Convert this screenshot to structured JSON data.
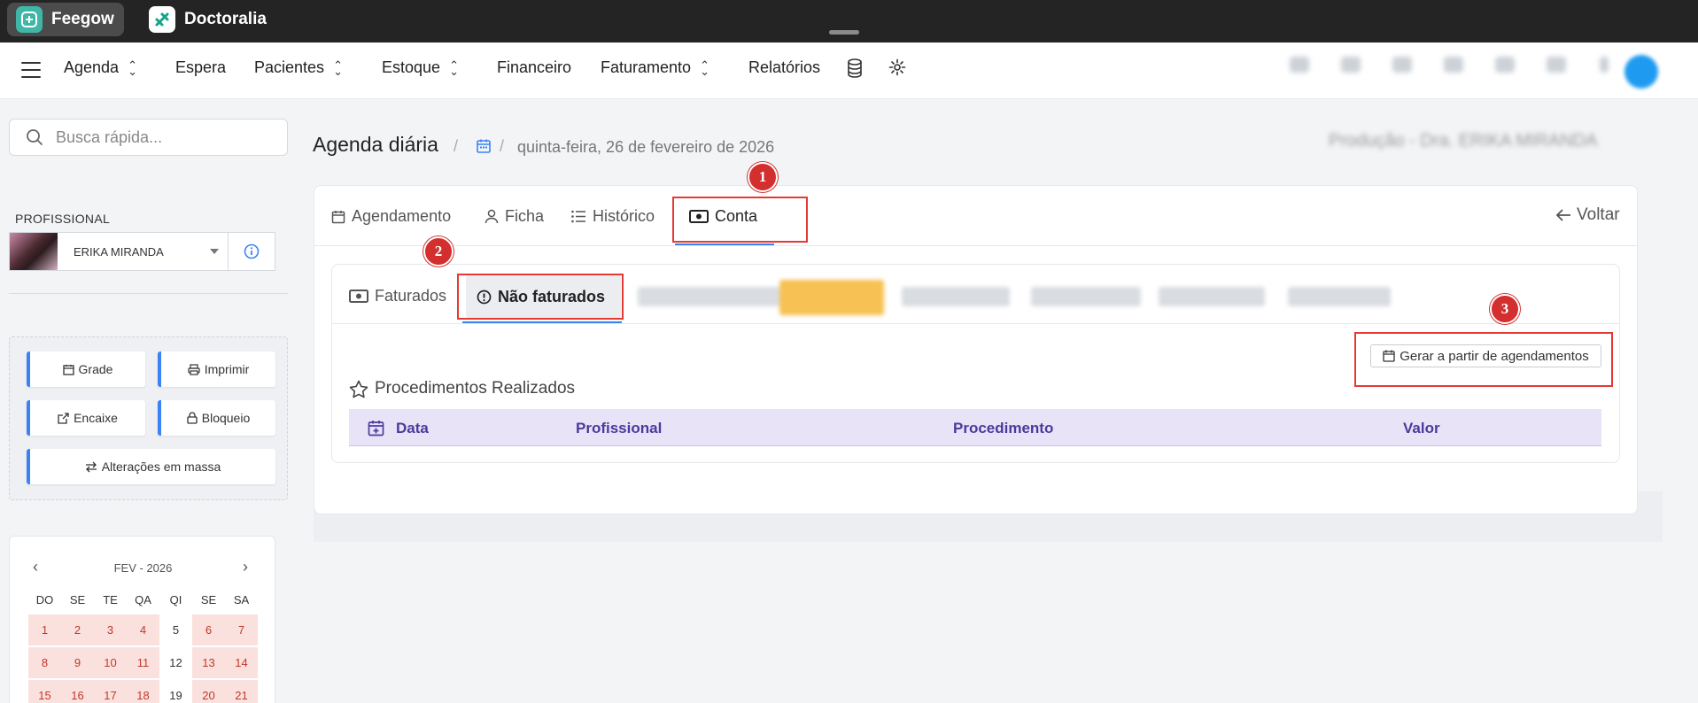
{
  "topbar": {
    "apps": [
      {
        "label": "Feegow",
        "active": true
      },
      {
        "label": "Doctoralia",
        "active": false
      }
    ]
  },
  "nav": {
    "items": [
      {
        "label": "Agenda",
        "dropdown": true
      },
      {
        "label": "Espera",
        "dropdown": false
      },
      {
        "label": "Pacientes",
        "dropdown": true
      },
      {
        "label": "Estoque",
        "dropdown": true
      },
      {
        "label": "Financeiro",
        "dropdown": false
      },
      {
        "label": "Faturamento",
        "dropdown": true
      },
      {
        "label": "Relatórios",
        "dropdown": false
      }
    ],
    "icons": [
      "database-icon",
      "gear-icon"
    ]
  },
  "sidebar": {
    "search_placeholder": "Busca rápida...",
    "profissional_label": "PROFISSIONAL",
    "profissional_name": "ERIKA MIRANDA",
    "actions": {
      "grade": "Grade",
      "imprimir": "Imprimir",
      "encaixe": "Encaixe",
      "bloqueio": "Bloqueio",
      "massa": "Alterações em massa"
    },
    "calendar": {
      "month": "FEV - 2026",
      "dow": [
        "DO",
        "SE",
        "TE",
        "QA",
        "QI",
        "SE",
        "SA"
      ],
      "days": [
        "1",
        "2",
        "3",
        "4",
        "5",
        "6",
        "7",
        "8",
        "9",
        "10",
        "11",
        "12",
        "13",
        "14",
        "15",
        "16",
        "17",
        "18",
        "19",
        "20",
        "21"
      ],
      "plain_days": [
        "5",
        "12",
        "19"
      ]
    }
  },
  "main": {
    "title": "Agenda diária",
    "breadcrumb_date": "quinta-feira, 26 de fevereiro de 2026",
    "header_blurred": "Produção - Dra. ERIKA MIRANDA",
    "tabs": [
      "Agendamento",
      "Ficha",
      "Histórico",
      "Conta"
    ],
    "active_tab": "Conta",
    "voltar": "Voltar",
    "subtabs": [
      "Faturados",
      "Não faturados"
    ],
    "active_subtab": "Não faturados",
    "gerar_button": "Gerar a partir de agendamentos",
    "section_title": "Procedimentos Realizados",
    "table_headers": [
      "Data",
      "Profissional",
      "Procedimento",
      "Valor"
    ]
  },
  "annotations": {
    "markers": [
      "1",
      "2",
      "3"
    ],
    "color": "#e53935"
  },
  "colors": {
    "accent": "#3b82f6",
    "table_header_bg": "#e9e3f8",
    "table_header_text": "#4b3a9c",
    "calendar_highlight": "#fbe1dd"
  }
}
